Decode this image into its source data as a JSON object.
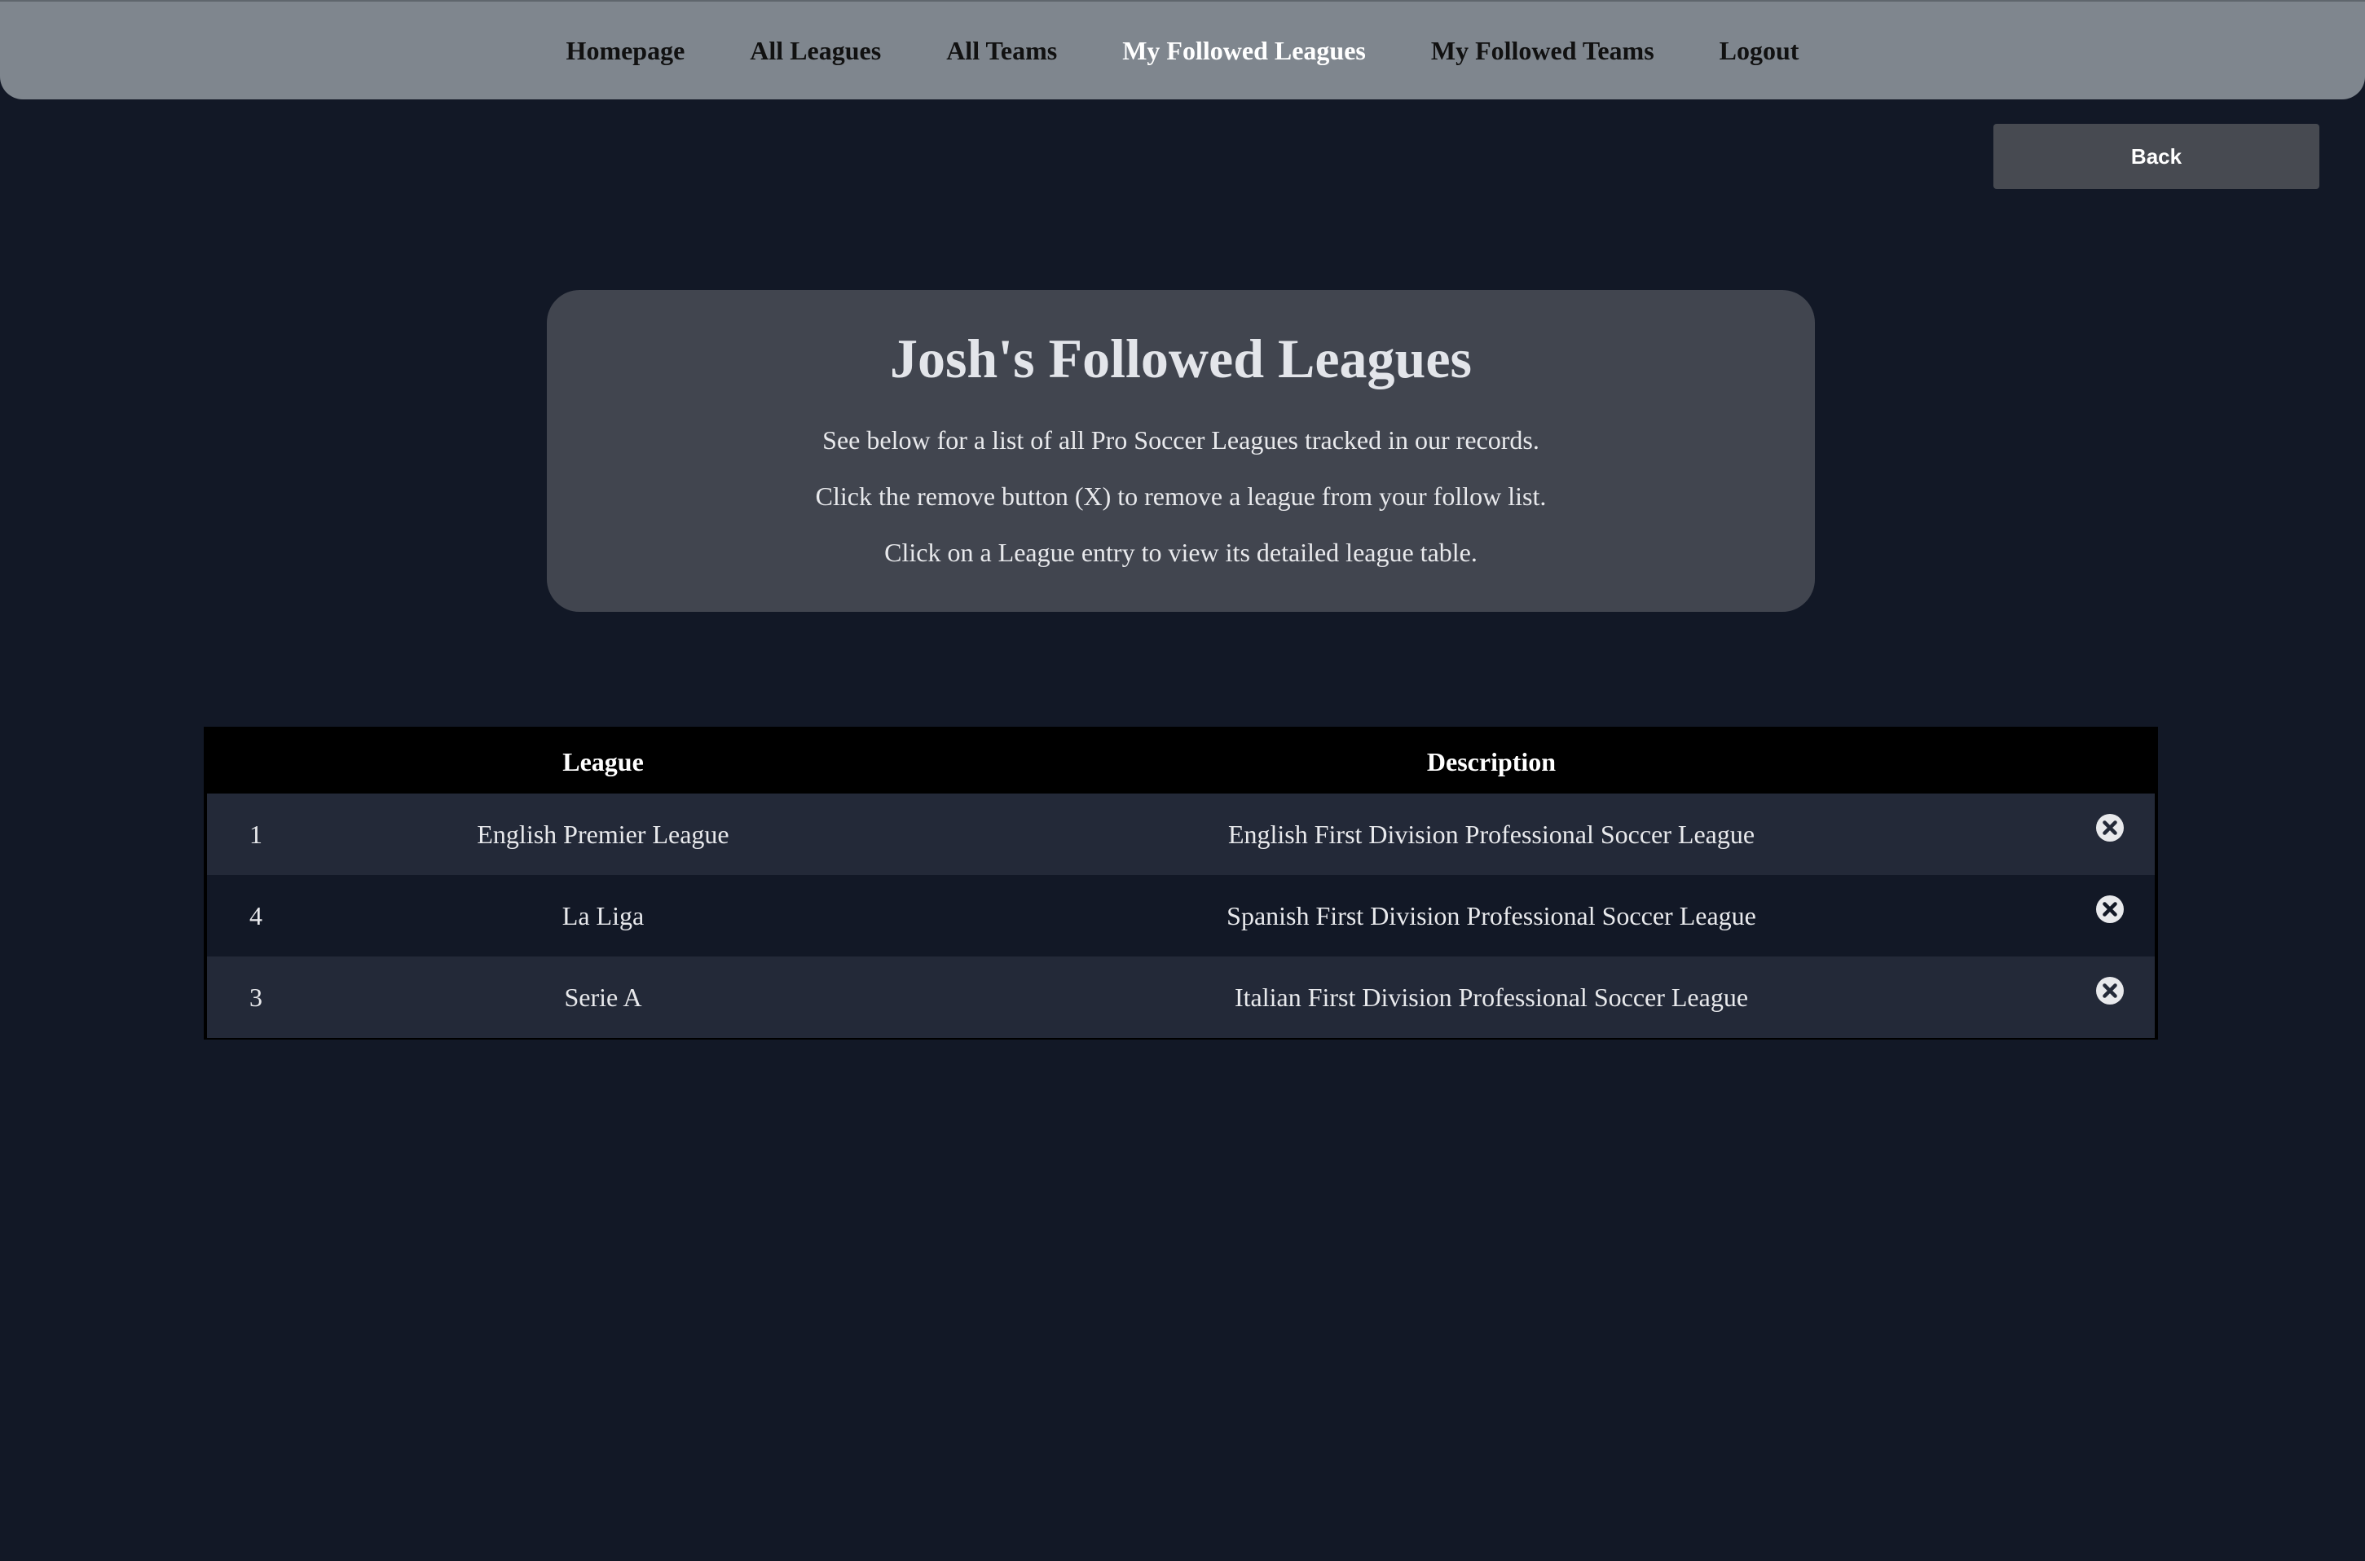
{
  "nav": {
    "items": [
      {
        "label": "Homepage",
        "active": false
      },
      {
        "label": "All Leagues",
        "active": false
      },
      {
        "label": "All Teams",
        "active": false
      },
      {
        "label": "My Followed Leagues",
        "active": true
      },
      {
        "label": "My Followed Teams",
        "active": false
      },
      {
        "label": "Logout",
        "active": false
      }
    ]
  },
  "back_button": {
    "label": "Back"
  },
  "info": {
    "title": "Josh's Followed Leagues",
    "lines": [
      "See below for a list of all Pro Soccer Leagues tracked in our records.",
      "Click the remove button (X) to remove a league from your follow list.",
      "Click on a League entry to view its detailed league table."
    ]
  },
  "table": {
    "headers": {
      "id": "",
      "league": "League",
      "description": "Description",
      "remove": ""
    },
    "rows": [
      {
        "id": "1",
        "league": "English Premier League",
        "description": "English First Division Professional Soccer League"
      },
      {
        "id": "4",
        "league": "La Liga",
        "description": "Spanish First Division Professional Soccer League"
      },
      {
        "id": "3",
        "league": "Serie A",
        "description": "Italian First Division Professional Soccer League"
      }
    ]
  },
  "icons": {
    "remove": "close-circle-icon"
  },
  "colors": {
    "background": "#121826",
    "navbar": "#7f868e",
    "card": "#41454f",
    "row_alt": "#232938",
    "table_header": "#000000",
    "button": "#474a51"
  }
}
